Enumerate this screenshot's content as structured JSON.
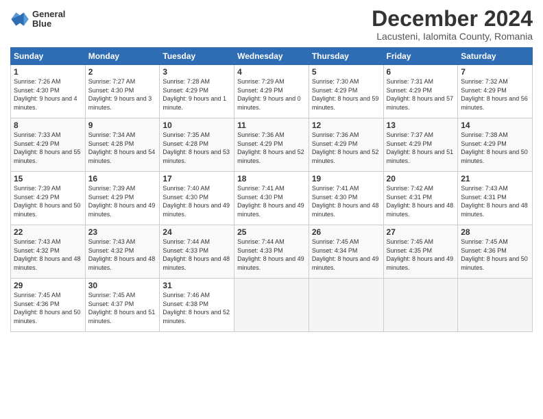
{
  "logo": {
    "name": "General Blue",
    "line1": "General",
    "line2": "Blue"
  },
  "title": "December 2024",
  "subtitle": "Lacusteni, Ialomita County, Romania",
  "days_of_week": [
    "Sunday",
    "Monday",
    "Tuesday",
    "Wednesday",
    "Thursday",
    "Friday",
    "Saturday"
  ],
  "weeks": [
    [
      {
        "day": 1,
        "sunrise": "7:26 AM",
        "sunset": "4:30 PM",
        "daylight": "9 hours and 4 minutes."
      },
      {
        "day": 2,
        "sunrise": "7:27 AM",
        "sunset": "4:30 PM",
        "daylight": "9 hours and 3 minutes."
      },
      {
        "day": 3,
        "sunrise": "7:28 AM",
        "sunset": "4:29 PM",
        "daylight": "9 hours and 1 minute."
      },
      {
        "day": 4,
        "sunrise": "7:29 AM",
        "sunset": "4:29 PM",
        "daylight": "9 hours and 0 minutes."
      },
      {
        "day": 5,
        "sunrise": "7:30 AM",
        "sunset": "4:29 PM",
        "daylight": "8 hours and 59 minutes."
      },
      {
        "day": 6,
        "sunrise": "7:31 AM",
        "sunset": "4:29 PM",
        "daylight": "8 hours and 57 minutes."
      },
      {
        "day": 7,
        "sunrise": "7:32 AM",
        "sunset": "4:29 PM",
        "daylight": "8 hours and 56 minutes."
      }
    ],
    [
      {
        "day": 8,
        "sunrise": "7:33 AM",
        "sunset": "4:29 PM",
        "daylight": "8 hours and 55 minutes."
      },
      {
        "day": 9,
        "sunrise": "7:34 AM",
        "sunset": "4:28 PM",
        "daylight": "8 hours and 54 minutes."
      },
      {
        "day": 10,
        "sunrise": "7:35 AM",
        "sunset": "4:28 PM",
        "daylight": "8 hours and 53 minutes."
      },
      {
        "day": 11,
        "sunrise": "7:36 AM",
        "sunset": "4:29 PM",
        "daylight": "8 hours and 52 minutes."
      },
      {
        "day": 12,
        "sunrise": "7:36 AM",
        "sunset": "4:29 PM",
        "daylight": "8 hours and 52 minutes."
      },
      {
        "day": 13,
        "sunrise": "7:37 AM",
        "sunset": "4:29 PM",
        "daylight": "8 hours and 51 minutes."
      },
      {
        "day": 14,
        "sunrise": "7:38 AM",
        "sunset": "4:29 PM",
        "daylight": "8 hours and 50 minutes."
      }
    ],
    [
      {
        "day": 15,
        "sunrise": "7:39 AM",
        "sunset": "4:29 PM",
        "daylight": "8 hours and 50 minutes."
      },
      {
        "day": 16,
        "sunrise": "7:39 AM",
        "sunset": "4:29 PM",
        "daylight": "8 hours and 49 minutes."
      },
      {
        "day": 17,
        "sunrise": "7:40 AM",
        "sunset": "4:30 PM",
        "daylight": "8 hours and 49 minutes."
      },
      {
        "day": 18,
        "sunrise": "7:41 AM",
        "sunset": "4:30 PM",
        "daylight": "8 hours and 49 minutes."
      },
      {
        "day": 19,
        "sunrise": "7:41 AM",
        "sunset": "4:30 PM",
        "daylight": "8 hours and 48 minutes."
      },
      {
        "day": 20,
        "sunrise": "7:42 AM",
        "sunset": "4:31 PM",
        "daylight": "8 hours and 48 minutes."
      },
      {
        "day": 21,
        "sunrise": "7:43 AM",
        "sunset": "4:31 PM",
        "daylight": "8 hours and 48 minutes."
      }
    ],
    [
      {
        "day": 22,
        "sunrise": "7:43 AM",
        "sunset": "4:32 PM",
        "daylight": "8 hours and 48 minutes."
      },
      {
        "day": 23,
        "sunrise": "7:43 AM",
        "sunset": "4:32 PM",
        "daylight": "8 hours and 48 minutes."
      },
      {
        "day": 24,
        "sunrise": "7:44 AM",
        "sunset": "4:33 PM",
        "daylight": "8 hours and 48 minutes."
      },
      {
        "day": 25,
        "sunrise": "7:44 AM",
        "sunset": "4:33 PM",
        "daylight": "8 hours and 49 minutes."
      },
      {
        "day": 26,
        "sunrise": "7:45 AM",
        "sunset": "4:34 PM",
        "daylight": "8 hours and 49 minutes."
      },
      {
        "day": 27,
        "sunrise": "7:45 AM",
        "sunset": "4:35 PM",
        "daylight": "8 hours and 49 minutes."
      },
      {
        "day": 28,
        "sunrise": "7:45 AM",
        "sunset": "4:36 PM",
        "daylight": "8 hours and 50 minutes."
      }
    ],
    [
      {
        "day": 29,
        "sunrise": "7:45 AM",
        "sunset": "4:36 PM",
        "daylight": "8 hours and 50 minutes."
      },
      {
        "day": 30,
        "sunrise": "7:45 AM",
        "sunset": "4:37 PM",
        "daylight": "8 hours and 51 minutes."
      },
      {
        "day": 31,
        "sunrise": "7:46 AM",
        "sunset": "4:38 PM",
        "daylight": "8 hours and 52 minutes."
      },
      null,
      null,
      null,
      null
    ]
  ]
}
